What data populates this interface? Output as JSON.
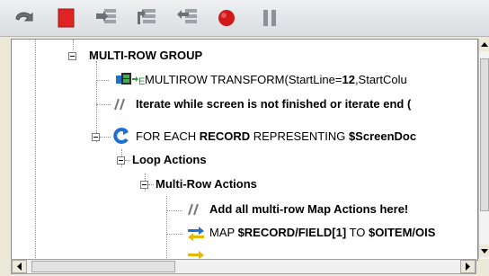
{
  "toolbar": {
    "buttons": [
      {
        "name": "undo-icon"
      },
      {
        "name": "stop-square-icon",
        "color": "#e02424"
      },
      {
        "name": "step-into-icon"
      },
      {
        "name": "step-over-icon"
      },
      {
        "name": "step-out-icon"
      },
      {
        "name": "record-icon",
        "color": "#d01818"
      },
      {
        "name": "pause-icon"
      }
    ]
  },
  "tree": {
    "group": {
      "label": "MULTI-ROW GROUP"
    },
    "transform": {
      "prefix": "MULTIROW TRANSFORM(StartLine=",
      "start_line": "12",
      "suffix": ",StartColu"
    },
    "comment1": {
      "label": "Iterate while screen is not finished or iterate end ("
    },
    "foreach": {
      "prefix": "FOR EACH ",
      "record": "RECORD",
      "middle": " REPRESENTING ",
      "var": "$ScreenDoc"
    },
    "loop_actions": {
      "label": "Loop Actions"
    },
    "multirow_actions": {
      "label": "Multi-Row Actions"
    },
    "comment2": {
      "label": "Add all multi-row Map Actions here!"
    },
    "map1": {
      "prefix": "MAP ",
      "src": "$RECORD/FIELD[1]",
      "middle": " TO ",
      "dst": "$OITEM/OIS"
    }
  },
  "colors": {
    "accent_blue": "#1f6fd1",
    "record_red": "#d01818",
    "stop_red": "#e02424"
  }
}
